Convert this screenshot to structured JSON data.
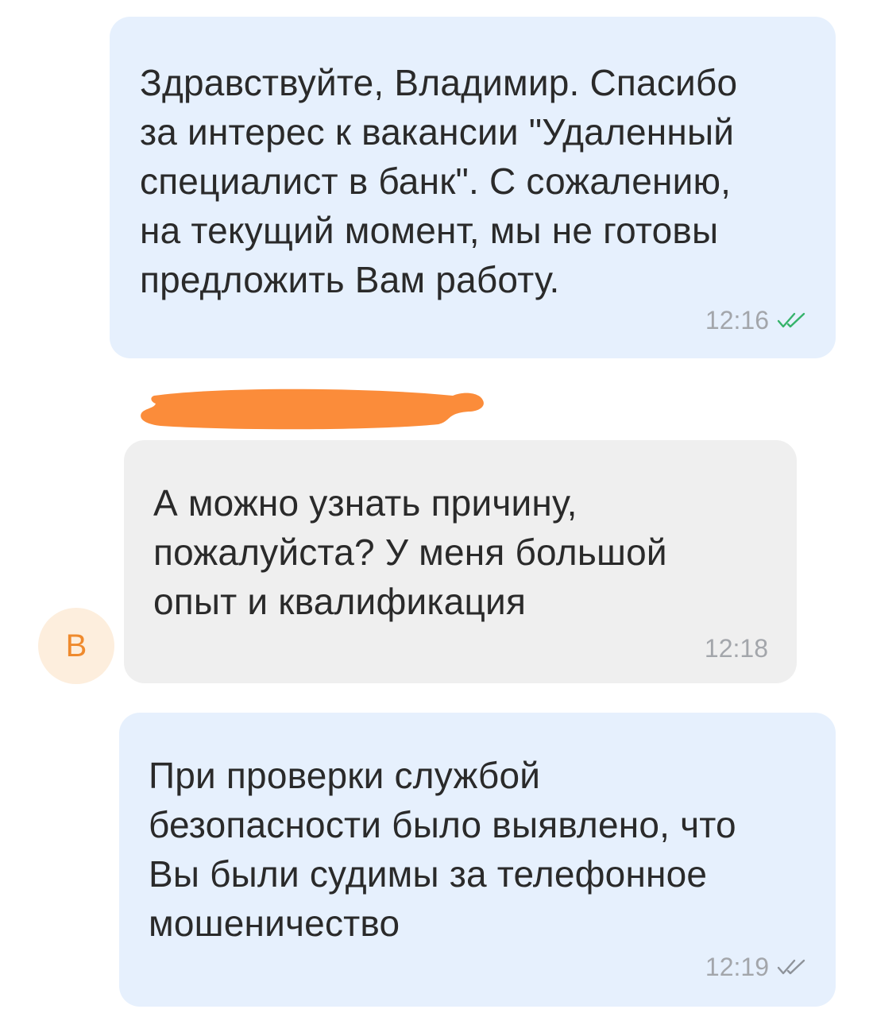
{
  "messages": [
    {
      "direction": "outgoing",
      "text": "Здравствуйте, Владимир. Спасибо\nза интерес к вакансии \"Удаленный\nспециалист в банк\". С сожалению,\nна текущий момент, мы не готовы\nпредложить Вам работу.",
      "time": "12:16",
      "status": "read"
    },
    {
      "direction": "incoming",
      "text": "А можно узнать причину,\nпожалуйста? У меня большой\nопыт и квалификация",
      "time": "12:18",
      "avatar_initial": "В"
    },
    {
      "direction": "outgoing",
      "text": "При проверки службой\nбезопасности было выявлено, что\nВы были судимы за телефонное\nмошеничество",
      "time": "12:19",
      "status": "delivered"
    }
  ],
  "colors": {
    "outgoing_bubble": "#e6f0fd",
    "incoming_bubble": "#efefef",
    "read_ticks": "#35b36a",
    "delivered_ticks": "#8e939a",
    "avatar_background": "#fdeedd",
    "avatar_text": "#ef8a2d",
    "redaction": "#fb8c3a"
  },
  "icons": {
    "read_status": "double-check-icon",
    "delivered_status": "double-check-icon"
  }
}
